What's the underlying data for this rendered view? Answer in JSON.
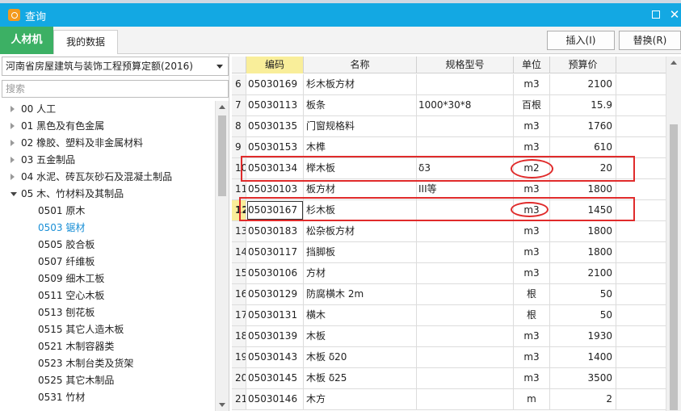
{
  "window": {
    "title": "查询"
  },
  "tabs": [
    {
      "label": "人材机"
    },
    {
      "label": "我的数据"
    }
  ],
  "toolbar": {
    "insert_label": "插入(I)",
    "replace_label": "替换(R)"
  },
  "left": {
    "quota_selected": "河南省房屋建筑与装饰工程预算定额(2016)",
    "search_placeholder": "搜索",
    "tree": [
      {
        "label": "00 人工",
        "level": 0,
        "expanded": false
      },
      {
        "label": "01 黑色及有色金属",
        "level": 0,
        "expanded": false
      },
      {
        "label": "02 橡胶、塑料及非金属材料",
        "level": 0,
        "expanded": false
      },
      {
        "label": "03 五金制品",
        "level": 0,
        "expanded": false
      },
      {
        "label": "04 水泥、砖瓦灰砂石及混凝土制品",
        "level": 0,
        "expanded": false
      },
      {
        "label": "05 木、竹材料及其制品",
        "level": 0,
        "expanded": true
      },
      {
        "label": "0501 原木",
        "level": 1
      },
      {
        "label": "0503 锯材",
        "level": 1,
        "selected": true
      },
      {
        "label": "0505 胶合板",
        "level": 1
      },
      {
        "label": "0507 纤维板",
        "level": 1
      },
      {
        "label": "0509 细木工板",
        "level": 1
      },
      {
        "label": "0511 空心木板",
        "level": 1
      },
      {
        "label": "0513 刨花板",
        "level": 1
      },
      {
        "label": "0515 其它人造木板",
        "level": 1
      },
      {
        "label": "0521 木制容器类",
        "level": 1
      },
      {
        "label": "0523 木制台类及货架",
        "level": 1
      },
      {
        "label": "0525 其它木制品",
        "level": 1
      },
      {
        "label": "0531 竹材",
        "level": 1
      }
    ]
  },
  "table": {
    "headers": {
      "code": "编码",
      "name": "名称",
      "spec": "规格型号",
      "unit": "单位",
      "price": "预算价"
    },
    "rows": [
      {
        "no": "6",
        "code": "05030169",
        "name": "杉木板方材",
        "spec": "",
        "unit": "m3",
        "price": "2100"
      },
      {
        "no": "7",
        "code": "05030113",
        "name": "板条",
        "spec": "1000*30*8",
        "unit": "百根",
        "price": "15.9"
      },
      {
        "no": "8",
        "code": "05030135",
        "name": "门窗规格料",
        "spec": "",
        "unit": "m3",
        "price": "1760"
      },
      {
        "no": "9",
        "code": "05030153",
        "name": "木榫",
        "spec": "",
        "unit": "m3",
        "price": "610"
      },
      {
        "no": "10",
        "code": "05030134",
        "name": "榉木板",
        "spec": "δ3",
        "unit": "m2",
        "price": "20"
      },
      {
        "no": "11",
        "code": "05030103",
        "name": "板方材",
        "spec": "III等",
        "unit": "m3",
        "price": "1800"
      },
      {
        "no": "12",
        "code": "05030167",
        "name": "杉木板",
        "spec": "",
        "unit": "m3",
        "price": "1450",
        "current": true
      },
      {
        "no": "13",
        "code": "05030183",
        "name": "松杂板方材",
        "spec": "",
        "unit": "m3",
        "price": "1800"
      },
      {
        "no": "14",
        "code": "05030117",
        "name": "挡脚板",
        "spec": "",
        "unit": "m3",
        "price": "1800"
      },
      {
        "no": "15",
        "code": "05030106",
        "name": "方材",
        "spec": "",
        "unit": "m3",
        "price": "2100"
      },
      {
        "no": "16",
        "code": "05030129",
        "name": "防腐横木 2m",
        "spec": "",
        "unit": "根",
        "price": "50"
      },
      {
        "no": "17",
        "code": "05030131",
        "name": "横木",
        "spec": "",
        "unit": "根",
        "price": "50"
      },
      {
        "no": "18",
        "code": "05030139",
        "name": "木板",
        "spec": "",
        "unit": "m3",
        "price": "1930"
      },
      {
        "no": "19",
        "code": "05030143",
        "name": "木板 δ20",
        "spec": "",
        "unit": "m3",
        "price": "1400"
      },
      {
        "no": "20",
        "code": "05030145",
        "name": "木板 δ25",
        "spec": "",
        "unit": "m3",
        "price": "3500"
      },
      {
        "no": "21",
        "code": "05030146",
        "name": "木方",
        "spec": "",
        "unit": "m",
        "price": "2"
      }
    ]
  },
  "icons": {
    "app": "app-logo-icon",
    "maximize": "maximize-icon",
    "close": "close-icon",
    "dropdown": "chevron-down-icon"
  },
  "colors": {
    "titlebar": "#13a8e3",
    "active_tab": "#3cb064",
    "highlight": "#f9ee9a",
    "annotation": "#e02b2b",
    "selected_tree": "#1a8fd6"
  }
}
